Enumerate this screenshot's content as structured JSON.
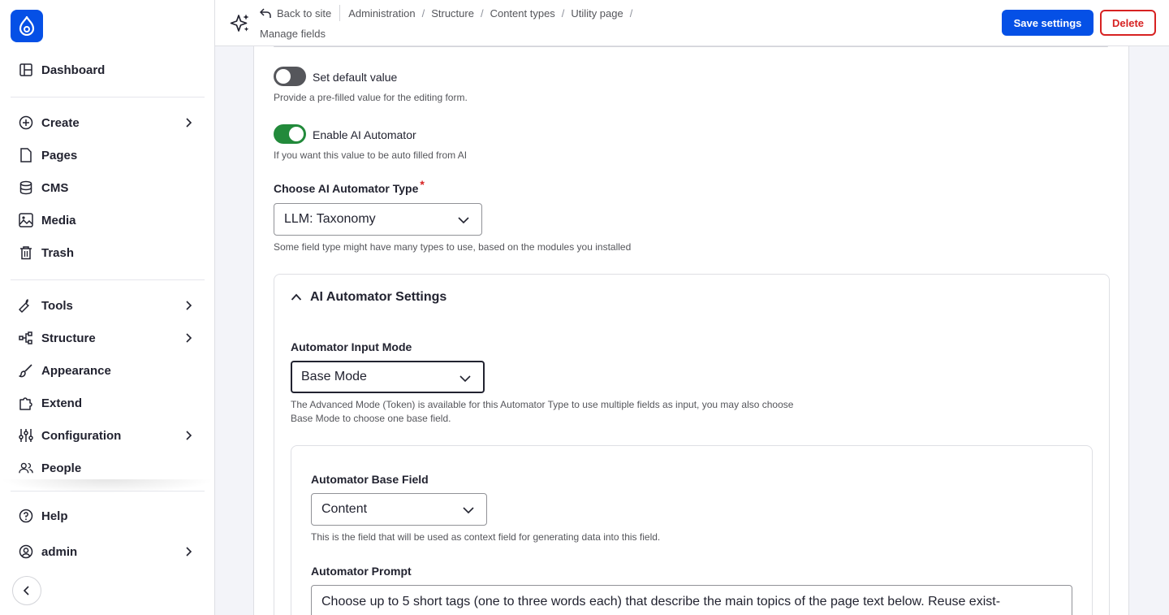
{
  "sidebar": {
    "items": [
      {
        "label": "Dashboard",
        "icon": "dashboard-icon"
      },
      {
        "label": "Create",
        "icon": "plus-circle-icon"
      },
      {
        "label": "Pages",
        "icon": "page-icon"
      },
      {
        "label": "CMS",
        "icon": "database-icon"
      },
      {
        "label": "Media",
        "icon": "image-icon"
      },
      {
        "label": "Trash",
        "icon": "trash-icon"
      },
      {
        "label": "Tools",
        "icon": "wrench-icon"
      },
      {
        "label": "Structure",
        "icon": "structure-icon"
      },
      {
        "label": "Appearance",
        "icon": "brush-icon"
      },
      {
        "label": "Extend",
        "icon": "puzzle-icon"
      },
      {
        "label": "Configuration",
        "icon": "sliders-icon"
      },
      {
        "label": "People",
        "icon": "people-icon"
      },
      {
        "label": "Help",
        "icon": "help-icon"
      },
      {
        "label": "admin",
        "icon": "user-icon"
      }
    ]
  },
  "header": {
    "back": "Back to site",
    "crumbs": [
      "Administration",
      "Structure",
      "Content types",
      "Utility page"
    ],
    "separator": "/",
    "current": "Manage fields",
    "save": "Save settings",
    "delete": "Delete"
  },
  "form": {
    "default_value": {
      "label": "Set default value",
      "desc": "Provide a pre-filled value for the editing form.",
      "enabled": false
    },
    "ai_automator": {
      "label": "Enable AI Automator",
      "desc": "If you want this value to be auto filled from AI",
      "enabled": true
    },
    "type": {
      "label": "Choose AI Automator Type",
      "required": "*",
      "value": "LLM: Taxonomy",
      "desc": "Some field type might have many types to use, based on the modules you installed"
    },
    "settings": {
      "title": "AI Automator Settings",
      "input_mode": {
        "label": "Automator Input Mode",
        "value": "Base Mode",
        "desc": "The Advanced Mode (Token) is available for this Automator Type to use multiple fields as input, you may also choose Base Mode to choose one base field."
      },
      "base_field": {
        "label": "Automator Base Field",
        "value": "Content",
        "desc": "This is the field that will be used as context field for generating data into this field."
      },
      "prompt": {
        "label": "Automator Prompt",
        "value": "Choose up to 5 short tags (one to three words each) that describe the main topics of the page text below. Reuse exist-"
      }
    }
  },
  "colors": {
    "accent": "#0550e6",
    "danger": "#d72222",
    "toggle_on": "#228a3b",
    "toggle_off": "#55565b"
  }
}
